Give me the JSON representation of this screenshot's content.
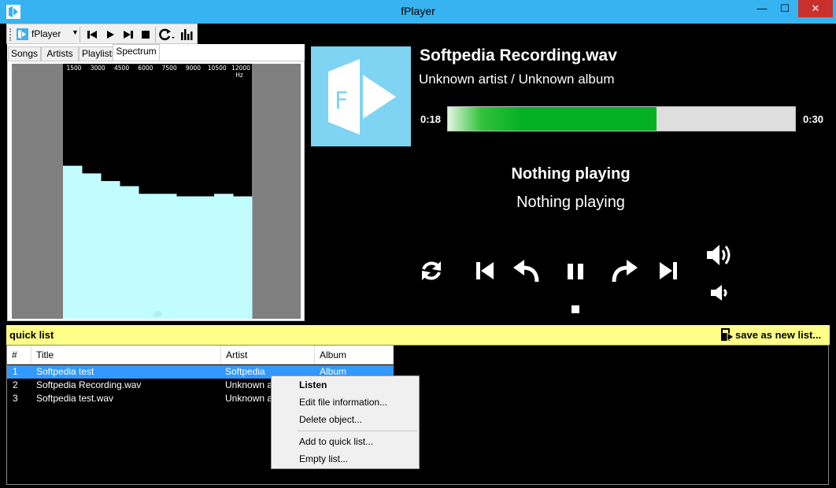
{
  "window": {
    "title": "fPlayer",
    "minimize_label": "—",
    "maximize_label": "☐",
    "close_label": "✕"
  },
  "toolbar": {
    "app_label": "fPlayer",
    "buttons": [
      "previous-icon",
      "play-icon",
      "next-icon",
      "stop-icon",
      "repeat-icon",
      "equalizer-icon"
    ]
  },
  "tabs": [
    "Songs",
    "Artists",
    "Playlists",
    "Spectrum"
  ],
  "active_tab": "Spectrum",
  "spectrum": {
    "frequency_labels": [
      "1500",
      "3000",
      "4500",
      "6000",
      "7500",
      "9000",
      "10500",
      "12000"
    ],
    "unit_label": "Hz",
    "bottom_label": "dB",
    "levels": [
      0.6,
      0.57,
      0.54,
      0.52,
      0.49,
      0.49,
      0.48,
      0.48,
      0.49,
      0.48
    ],
    "bar_color": "#c1fdff",
    "side_color": "#808080"
  },
  "now_playing": {
    "title": "Softpedia Recording.wav",
    "subtitle": "Unknown artist / Unknown album",
    "time_current": "0:18",
    "time_total": "0:30",
    "progress": 0.6,
    "status_title": "Nothing playing",
    "status_subtitle": "Nothing playing",
    "cover_letter": "F"
  },
  "quick_list": {
    "label": "quick list",
    "save_label": "save as new list..."
  },
  "list": {
    "columns": [
      "#",
      "Title",
      "Artist",
      "Album"
    ],
    "rows": [
      {
        "num": "1",
        "title": "Softpedia test",
        "artist": "Softpedia",
        "album": "Album"
      },
      {
        "num": "2",
        "title": "Softpedia Recording.wav",
        "artist": "Unknown ar",
        "album": ""
      },
      {
        "num": "3",
        "title": "Softpedia test.wav",
        "artist": "Unknown ar",
        "album": ""
      }
    ],
    "selected_row": 0
  },
  "context_menu": {
    "items": [
      "Listen",
      "Edit file information...",
      "Delete object...",
      "Add to quick list...",
      "Empty list..."
    ]
  },
  "colors": {
    "titlebar": "#36b3f0",
    "accent": "#7fd3f3",
    "progress": "#06b024",
    "quickbar": "#ffff88",
    "selection": "#3399ff"
  }
}
